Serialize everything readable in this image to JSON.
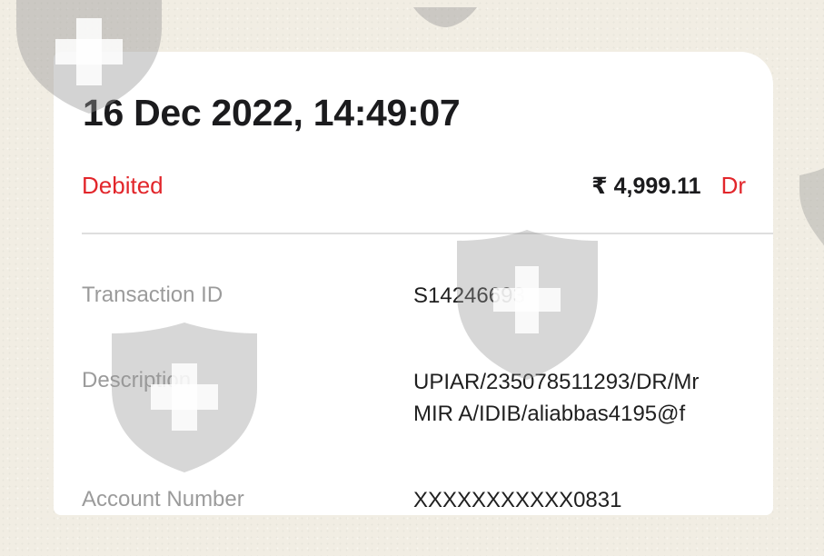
{
  "transaction": {
    "datetime": "16 Dec 2022, 14:49:07",
    "status": "Debited",
    "amount": "₹ 4,999.11",
    "type": "Dr"
  },
  "details": [
    {
      "label": "Transaction ID",
      "value_lines": [
        "S14246693"
      ]
    },
    {
      "label": "Description",
      "value_lines": [
        "UPIAR/235078511293/DR/Mr",
        "MIR A/IDIB/aliabbas4195@f"
      ]
    },
    {
      "label": "Account Number",
      "value_lines": [
        "XXXXXXXXXXX0831"
      ]
    }
  ],
  "watermark": {
    "icon": "shield-plus-icon"
  },
  "colors": {
    "accent_red": "#e2262b",
    "text_dark": "#1b1b1d",
    "label_gray": "#9b9b9b",
    "background": "#f1ede3"
  }
}
